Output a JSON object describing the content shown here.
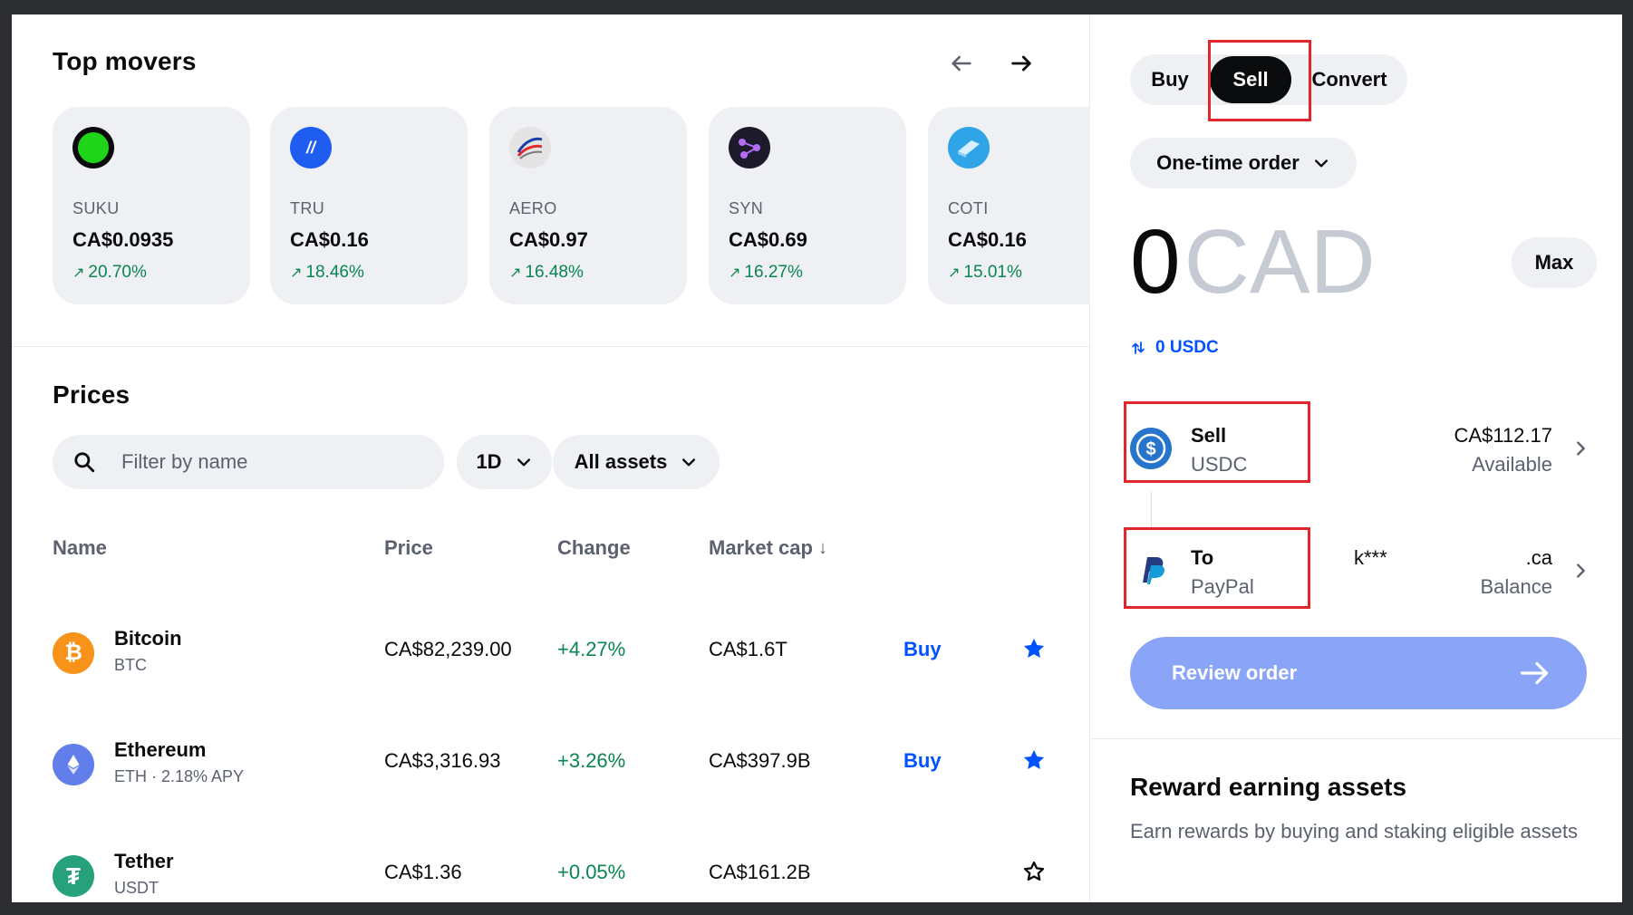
{
  "top_movers": {
    "title": "Top movers",
    "cards": [
      {
        "symbol": "SUKU",
        "price": "CA$0.0935",
        "change": "20.70%",
        "icon": "suku-coin-icon"
      },
      {
        "symbol": "TRU",
        "price": "CA$0.16",
        "change": "18.46%",
        "icon": "tru-coin-icon"
      },
      {
        "symbol": "AERO",
        "price": "CA$0.97",
        "change": "16.48%",
        "icon": "aero-coin-icon"
      },
      {
        "symbol": "SYN",
        "price": "CA$0.69",
        "change": "16.27%",
        "icon": "syn-coin-icon"
      },
      {
        "symbol": "COTI",
        "price": "CA$0.16",
        "change": "15.01%",
        "icon": "coti-coin-icon"
      }
    ]
  },
  "prices": {
    "title": "Prices",
    "search_placeholder": "Filter by name",
    "timeframe": "1D",
    "asset_filter": "All assets",
    "columns": {
      "name": "Name",
      "price": "Price",
      "change": "Change",
      "market_cap": "Market cap"
    },
    "rows": [
      {
        "name": "Bitcoin",
        "sub": "BTC",
        "price": "CA$82,239.00",
        "change": "+4.27%",
        "market_cap": "CA$1.6T",
        "buy": "Buy",
        "starred": true
      },
      {
        "name": "Ethereum",
        "sub": "ETH · 2.18% APY",
        "price": "CA$3,316.93",
        "change": "+3.26%",
        "market_cap": "CA$397.9B",
        "buy": "Buy",
        "starred": true
      },
      {
        "name": "Tether",
        "sub": "USDT",
        "price": "CA$1.36",
        "change": "+0.05%",
        "market_cap": "CA$161.2B",
        "buy": "",
        "starred": false
      }
    ]
  },
  "trade": {
    "tabs": {
      "buy": "Buy",
      "sell": "Sell",
      "convert": "Convert"
    },
    "active_tab": "Sell",
    "order_type": "One-time order",
    "amount": "0",
    "currency": "CAD",
    "max_label": "Max",
    "alt_amount": "0 USDC",
    "sell_asset": {
      "title": "Sell",
      "asset": "USDC",
      "amount": "CA$112.17",
      "amount_label": "Available"
    },
    "destination": {
      "title": "To",
      "method": "PayPal",
      "account_masked": "k***",
      "account_suffix": ".ca",
      "detail": "Balance"
    },
    "review_label": "Review order"
  },
  "rewards": {
    "title": "Reward earning assets",
    "description": "Earn rewards by buying and staking eligible assets"
  },
  "colors": {
    "accent_blue": "#0052ff",
    "positive_green": "#098551",
    "review_button": "#8aa4f8",
    "highlight_red": "#e0262b"
  }
}
